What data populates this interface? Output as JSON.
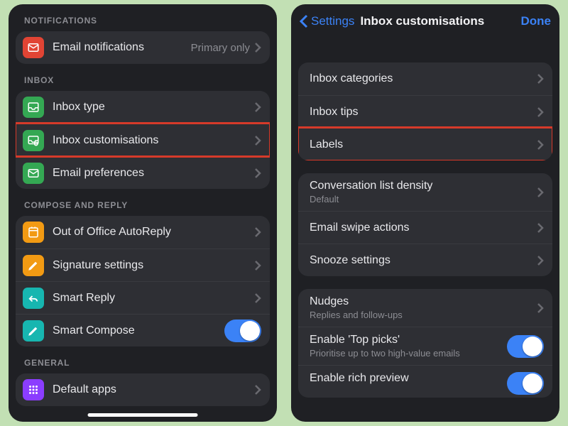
{
  "left": {
    "sections": {
      "notifications": {
        "header": "NOTIFICATIONS",
        "emailNotifications": {
          "label": "Email notifications",
          "value": "Primary only"
        }
      },
      "inbox": {
        "header": "INBOX",
        "inboxType": {
          "label": "Inbox type"
        },
        "inboxCustomisations": {
          "label": "Inbox customisations"
        },
        "emailPreferences": {
          "label": "Email preferences"
        }
      },
      "compose": {
        "header": "COMPOSE AND REPLY",
        "outOfOffice": {
          "label": "Out of Office AutoReply"
        },
        "signature": {
          "label": "Signature settings"
        },
        "smartReply": {
          "label": "Smart Reply"
        },
        "smartCompose": {
          "label": "Smart Compose",
          "toggle": true
        }
      },
      "general": {
        "header": "GENERAL",
        "defaultApps": {
          "label": "Default apps"
        }
      }
    }
  },
  "right": {
    "nav": {
      "back": "Settings",
      "title": "Inbox customisations",
      "done": "Done"
    },
    "group1": {
      "categories": {
        "label": "Inbox categories"
      },
      "tips": {
        "label": "Inbox tips"
      },
      "labels": {
        "label": "Labels"
      }
    },
    "group2": {
      "density": {
        "label": "Conversation list density",
        "sub": "Default"
      },
      "swipe": {
        "label": "Email swipe actions"
      },
      "snooze": {
        "label": "Snooze settings"
      }
    },
    "group3": {
      "nudges": {
        "label": "Nudges",
        "sub": "Replies and follow-ups"
      },
      "topPicks": {
        "label": "Enable 'Top picks'",
        "sub": "Prioritise up to two high-value emails",
        "toggle": true
      },
      "richPreview": {
        "label": "Enable rich preview",
        "toggle": true
      }
    }
  },
  "colors": {
    "red": "#e14434",
    "green": "#34a853",
    "orange": "#f29a13",
    "teal": "#17b6b0",
    "purple": "#8b3dff"
  }
}
